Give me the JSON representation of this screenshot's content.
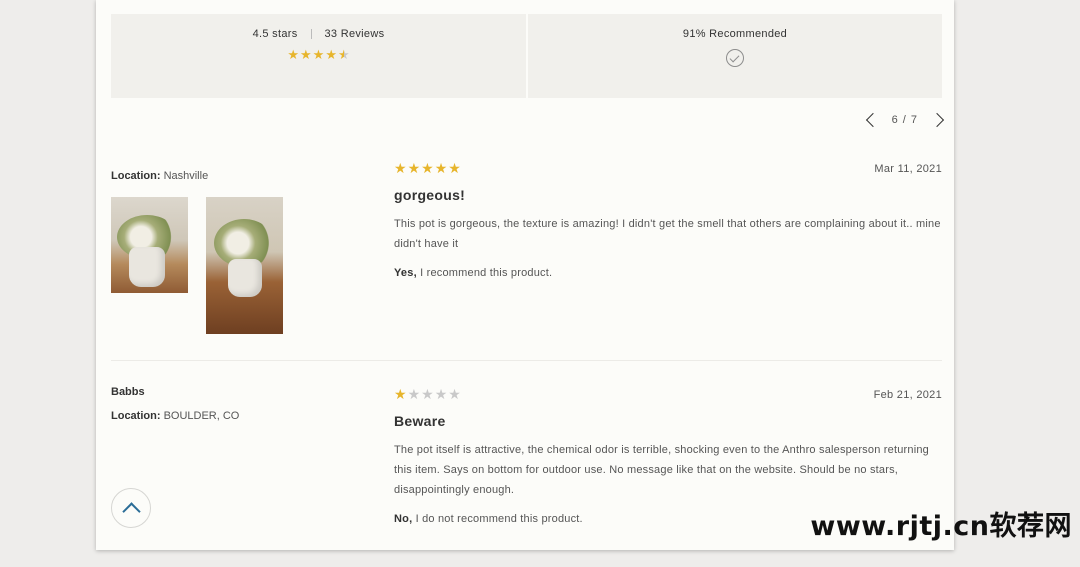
{
  "summary": {
    "stars_label": "4.5 stars",
    "rating": 4.5,
    "reviews_label": "33 Reviews",
    "recommended_label": "91% Recommended"
  },
  "pager": {
    "text": "6 / 7"
  },
  "reviews": [
    {
      "reviewer": "",
      "location_label": "Location:",
      "location": "Nashville",
      "rating": 5,
      "date": "Mar 11, 2021",
      "title": "gorgeous!",
      "body": "This pot is gorgeous, the texture is amazing! I didn't get the smell that others are complaining about it.. mine didn't have it",
      "recommend_answer": "Yes,",
      "recommend_text": " I recommend this product.",
      "photos": 2
    },
    {
      "reviewer": "Babbs",
      "location_label": "Location:",
      "location": "BOULDER, CO",
      "rating": 1,
      "date": "Feb 21, 2021",
      "title": "Beware",
      "body": "The pot itself is attractive, the chemical odor is terrible, shocking even to the Anthro salesperson returning this item. Says on bottom for outdoor use. No message like that on the website. Should be no stars, disappointingly enough.",
      "recommend_answer": "No,",
      "recommend_text": " I do not recommend this product.",
      "photos": 0
    }
  ],
  "watermark": "www.rjtj.cn软荐网",
  "colors": {
    "star": "#e7b52c",
    "star_empty": "#c9c9c9",
    "accent": "#2b6d97",
    "card": "#fcfcf9",
    "summary_box": "#f1f0ec"
  },
  "icons": [
    "chevron-left-icon",
    "chevron-right-icon",
    "check-circle-icon",
    "chevron-up-icon",
    "star-icon"
  ]
}
